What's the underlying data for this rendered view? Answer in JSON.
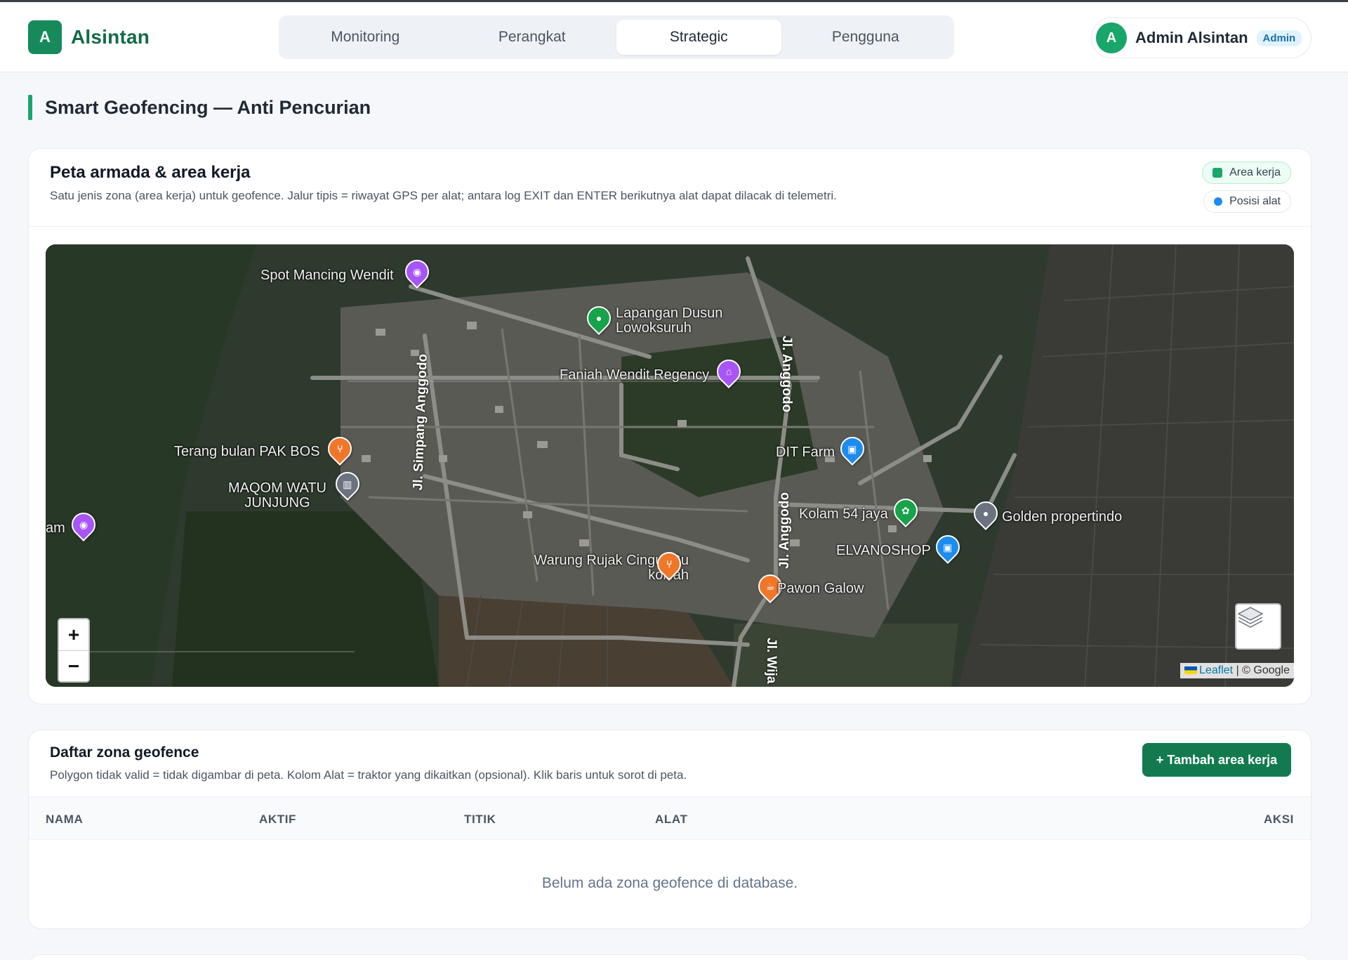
{
  "app": {
    "logo_letter": "A",
    "name": "Alsintan"
  },
  "nav": {
    "tabs": [
      {
        "label": "Monitoring",
        "active": false
      },
      {
        "label": "Perangkat",
        "active": false
      },
      {
        "label": "Strategic",
        "active": true
      },
      {
        "label": "Pengguna",
        "active": false
      }
    ]
  },
  "user": {
    "avatar_letter": "A",
    "name": "Admin Alsintan",
    "role": "Admin"
  },
  "page": {
    "title": "Smart Geofencing — Anti Pencurian"
  },
  "map_card": {
    "title": "Peta armada & area kerja",
    "description": "Satu jenis zona (area kerja) untuk geofence. Jalur tipis = riwayat GPS per alat; antara log EXIT dan ENTER berikutnya alat dapat dilacak di telemetri.",
    "legend": [
      {
        "label": "Area kerja",
        "color": "#18a66a"
      },
      {
        "label": "Posisi alat",
        "color": "#1d8cf0"
      }
    ]
  },
  "map": {
    "places": [
      {
        "label": "Spot Mancing Wendit",
        "icon": "camera-icon",
        "color": "#a855f7"
      },
      {
        "label": "Lapangan Dusun Lowoksuruh",
        "icon": "place-icon",
        "color": "#16a34a"
      },
      {
        "label": "Faniah Wendit Regency",
        "icon": "home-icon",
        "color": "#a855f7"
      },
      {
        "label": "Terang bulan PAK BOS",
        "icon": "restaurant-icon",
        "color": "#f0772a"
      },
      {
        "label": "MAQOM WATU JUNJUNG",
        "icon": "monument-icon",
        "color": "#6b7280"
      },
      {
        "label": "am",
        "icon": "camera-icon",
        "color": "#a855f7"
      },
      {
        "label": "DIT Farm",
        "icon": "shopping-icon",
        "color": "#1d8cf0"
      },
      {
        "label": "Kolam 54 jaya",
        "icon": "flower-icon",
        "color": "#16a34a"
      },
      {
        "label": "Golden propertindo",
        "icon": "place-icon",
        "color": "#6b7280"
      },
      {
        "label": "ELVANOSHOP",
        "icon": "shopping-icon",
        "color": "#1d8cf0"
      },
      {
        "label": "Warung Rujak Cingur Bu kolifah",
        "icon": "restaurant-icon",
        "color": "#f0772a"
      },
      {
        "label": "Pawon Galow",
        "icon": "cafe-icon",
        "color": "#f0772a"
      }
    ],
    "roads": [
      "Jl. Simpang Anggodo",
      "Jl. Anggodo",
      "Jl. Anggodo",
      "Jl. Wija"
    ],
    "zoom_in": "+",
    "zoom_out": "−",
    "attribution_link": "Leaflet",
    "attribution_rest": "| © Google"
  },
  "zone_card": {
    "title": "Daftar zona geofence",
    "description": "Polygon tidak valid = tidak digambar di peta. Kolom Alat = traktor yang dikaitkan (opsional). Klik baris untuk sorot di peta.",
    "add_button": "+ Tambah area kerja",
    "columns": [
      "NAMA",
      "AKTIF",
      "TITIK",
      "ALAT",
      "AKSI"
    ],
    "empty_message": "Belum ada zona geofence di database."
  }
}
